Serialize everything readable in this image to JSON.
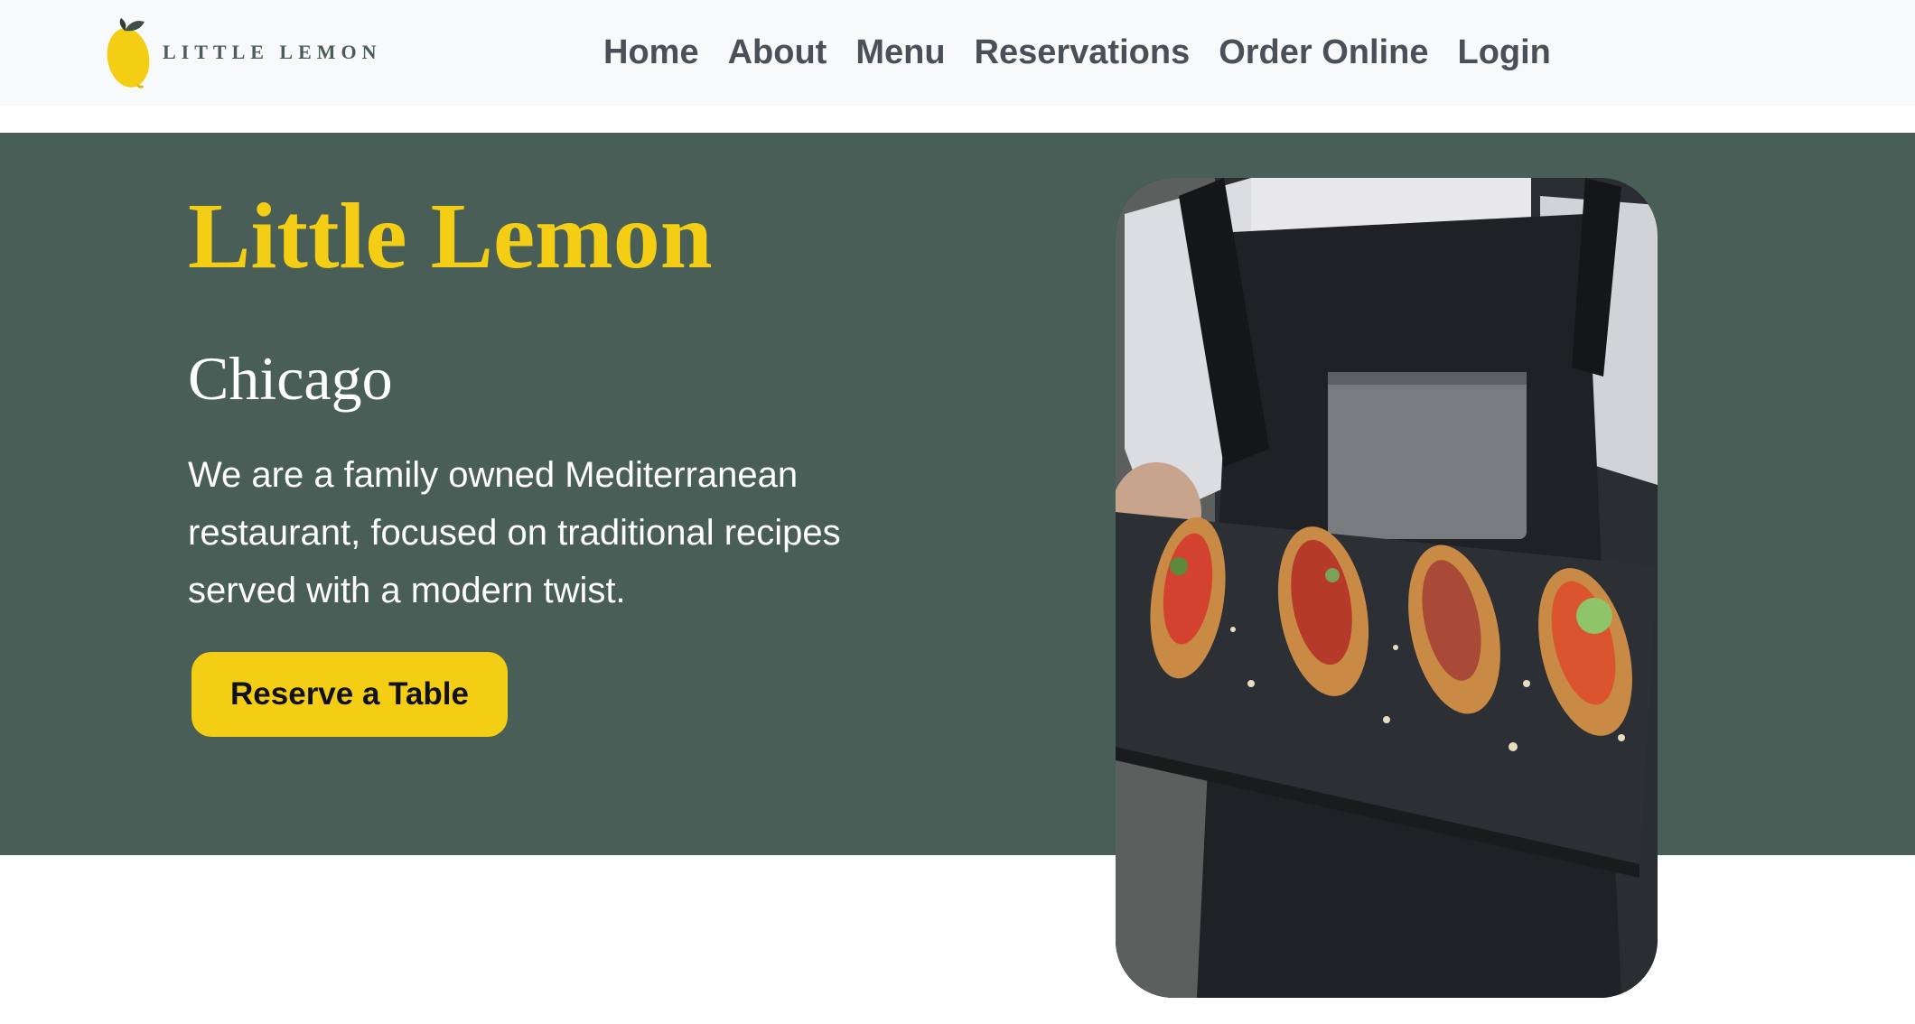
{
  "brand": {
    "logo_text": "LITTLE LEMON"
  },
  "nav": {
    "items": [
      {
        "label": "Home"
      },
      {
        "label": "About"
      },
      {
        "label": "Menu"
      },
      {
        "label": "Reservations"
      },
      {
        "label": "Order Online"
      },
      {
        "label": "Login"
      }
    ]
  },
  "hero": {
    "title": "Little Lemon",
    "city": "Chicago",
    "description": "We are a family owned Mediterranean restaurant, focused on traditional recipes served with a modern twist.",
    "cta_label": "Reserve a Table"
  },
  "colors": {
    "primary_green": "#495e57",
    "primary_yellow": "#f4ce14",
    "header_bg": "#f8f9fa",
    "nav_text": "#495057"
  }
}
